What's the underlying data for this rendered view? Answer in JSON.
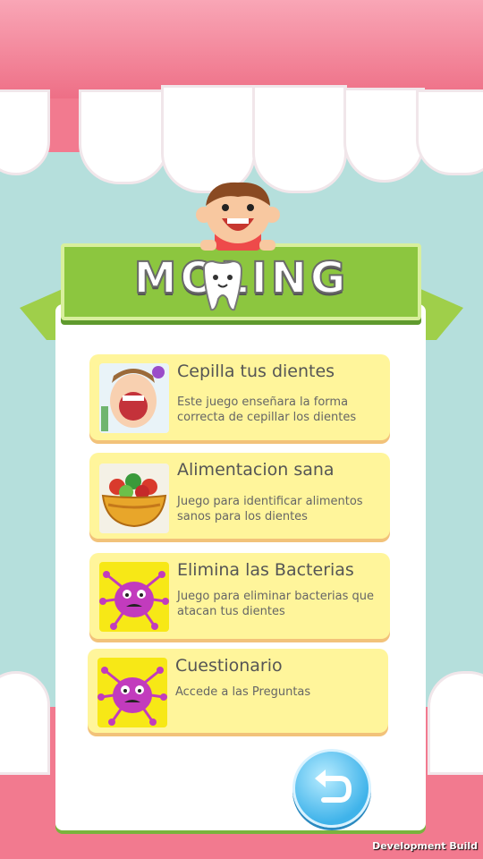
{
  "logo": {
    "text": "MOLING"
  },
  "cards": [
    {
      "title": "Cepilla tus dientes",
      "description": "Este juego enseñara la forma correcta de cepillar los dientes",
      "thumb": "kid-brushing-teeth-image"
    },
    {
      "title": "Alimentacion sana",
      "description": "Juego para identificar alimentos sanos para los dientes",
      "thumb": "salad-bowl-image"
    },
    {
      "title": "Elimina las Bacterias",
      "description": "Juego para eliminar bacterias que atacan tus dientes",
      "thumb": "bacteria-image"
    },
    {
      "title": "Cuestionario",
      "description": "Accede a las Preguntas",
      "thumb": "bacteria-image"
    }
  ],
  "back_button": {
    "icon": "back-arrow-icon"
  },
  "footer": {
    "dev_build": "Development Build"
  },
  "colors": {
    "gum": "#f27a8f",
    "card": "#fff59b",
    "ribbon": "#8cc63f",
    "button": "#3fb3ea",
    "germ": "#c23bbd"
  }
}
